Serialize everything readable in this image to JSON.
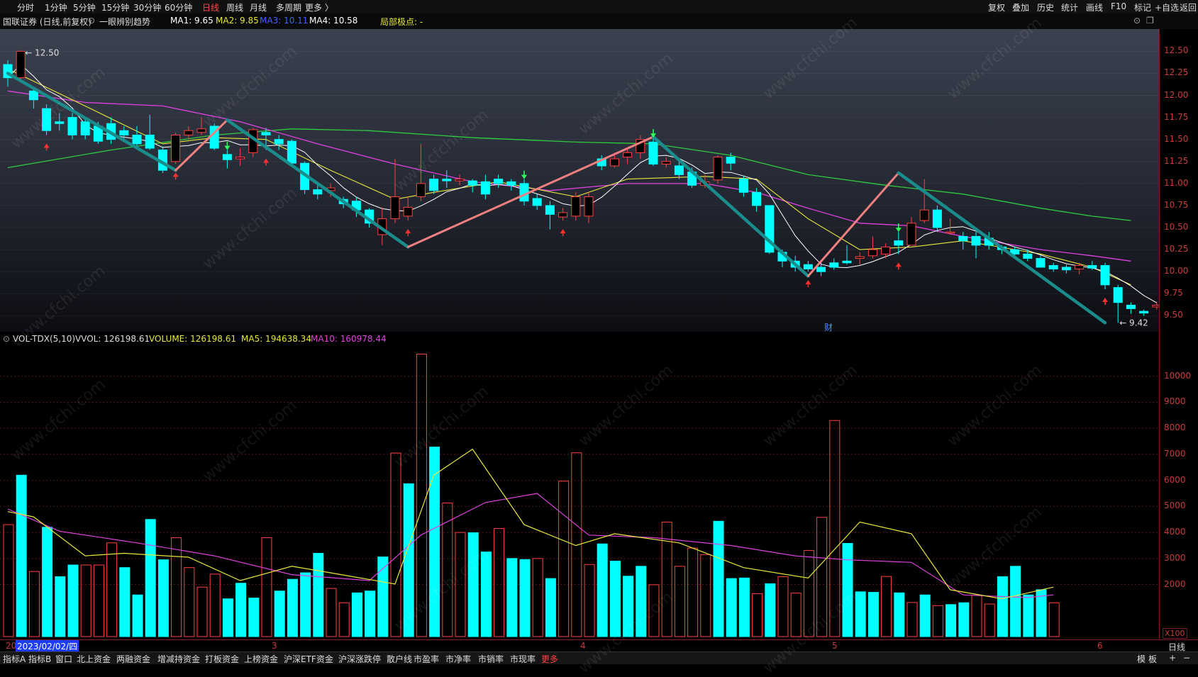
{
  "colors": {
    "up": "#ff4040",
    "down": "#00ffff",
    "ma1": "#ffffff",
    "ma2": "#e8e83a",
    "ma3": "#e040e0",
    "ma4": "#2ecc40",
    "zig_down": "#1a8c8c",
    "zig_up": "#f08080"
  },
  "topbar": {
    "periods": [
      "分时",
      "1分钟",
      "5分钟",
      "15分钟",
      "30分钟",
      "60分钟",
      "日线",
      "周线",
      "月线",
      "多周期",
      "更多 〉"
    ],
    "active_period": "日线",
    "right_tools": [
      "复权",
      "叠加",
      "历史",
      "统计",
      "画线",
      "F10",
      "标记",
      "+自选",
      "返回"
    ]
  },
  "info": {
    "stock": "国联证券 (日线,前复权)",
    "indicator": "一眼辨别趋势",
    "ma1": "MA1: 9.65",
    "ma2": "MA2: 9.85",
    "ma3": "MA3: 10.11",
    "ma4": "MA4: 10.58",
    "pivot": "局部极点: -"
  },
  "price_axis": [
    "12.50",
    "12.25",
    "12.00",
    "11.75",
    "11.50",
    "11.25",
    "11.00",
    "10.75",
    "10.50",
    "10.25",
    "10.00",
    "9.75",
    "9.50"
  ],
  "price_annotations": {
    "high": "12.50",
    "low": "9.42",
    "event": "财"
  },
  "vol_header": {
    "name": "VOL-TDX(5,10)",
    "vvol": "VVOL: 126198.61",
    "volume": "VOLUME: 126198.61",
    "ma5": "MA5: 194638.34",
    "ma10": "MA10: 160978.44"
  },
  "vol_axis": [
    "10000",
    "9000",
    "8000",
    "7000",
    "6000",
    "5000",
    "4000",
    "3000",
    "2000"
  ],
  "vol_unit": "X100",
  "date_bar": {
    "first": "20",
    "cursor_date": "2023/02/02/四",
    "months": [
      "3",
      "4",
      "5",
      "6"
    ],
    "right_label": "日线"
  },
  "bottom_tabs": [
    "指标A",
    "指标B",
    "窗口",
    "北上资金",
    "两融资金",
    "增减持资金",
    "打板资金",
    "上榜资金",
    "沪深ETF资金",
    "沪深涨跌停",
    "散户线",
    "市盈率",
    "市净率",
    "市销率",
    "市现率",
    "更多"
  ],
  "bottom_right": [
    "模",
    "板",
    "+",
    "−"
  ],
  "watermark": "www.cfchi.com",
  "chart_data": {
    "type": "candlestick",
    "ohlc": [
      [
        12.35,
        12.2,
        12.4,
        12.1
      ],
      [
        12.2,
        12.5,
        12.5,
        12.15
      ],
      [
        12.05,
        11.95,
        12.1,
        11.85
      ],
      [
        11.85,
        11.6,
        11.9,
        11.55
      ],
      [
        11.7,
        11.68,
        11.8,
        11.6
      ],
      [
        11.75,
        11.55,
        11.8,
        11.5
      ],
      [
        11.7,
        11.55,
        11.75,
        11.5
      ],
      [
        11.65,
        11.48,
        11.7,
        11.45
      ],
      [
        11.68,
        11.5,
        11.75,
        11.45
      ],
      [
        11.6,
        11.55,
        11.65,
        11.5
      ],
      [
        11.55,
        11.45,
        11.65,
        11.42
      ],
      [
        11.55,
        11.4,
        11.78,
        11.38
      ],
      [
        11.38,
        11.15,
        11.42,
        11.12
      ],
      [
        11.25,
        11.55,
        11.58,
        11.22
      ],
      [
        11.55,
        11.6,
        11.65,
        11.5
      ],
      [
        11.58,
        11.62,
        11.75,
        11.55
      ],
      [
        11.65,
        11.4,
        11.68,
        11.38
      ],
      [
        11.33,
        11.27,
        11.38,
        11.17
      ],
      [
        11.28,
        11.3,
        11.4,
        11.2
      ],
      [
        11.35,
        11.61,
        11.63,
        11.3
      ],
      [
        11.58,
        11.55,
        11.63,
        11.38
      ],
      [
        11.5,
        11.45,
        11.55,
        11.38
      ],
      [
        11.48,
        11.23,
        11.5,
        11.2
      ],
      [
        11.23,
        10.93,
        11.25,
        10.88
      ],
      [
        10.93,
        10.88,
        10.98,
        10.82
      ],
      [
        10.92,
        10.95,
        11.0,
        10.85
      ],
      [
        10.82,
        10.77,
        10.85,
        10.72
      ],
      [
        10.8,
        10.7,
        10.85,
        10.62
      ],
      [
        10.7,
        10.55,
        10.72,
        10.5
      ],
      [
        10.42,
        10.6,
        10.73,
        10.3
      ],
      [
        10.6,
        10.85,
        11.28,
        10.55
      ],
      [
        10.63,
        10.73,
        10.85,
        10.58
      ],
      [
        10.85,
        11.0,
        11.45,
        10.8
      ],
      [
        11.05,
        10.92,
        11.1,
        10.88
      ],
      [
        11.05,
        11.03,
        11.15,
        10.95
      ],
      [
        11.03,
        11.05,
        11.1,
        10.98
      ],
      [
        11.03,
        10.98,
        11.05,
        10.9
      ],
      [
        11.02,
        10.88,
        11.1,
        10.82
      ],
      [
        11.05,
        11.0,
        11.1,
        10.95
      ],
      [
        11.02,
        10.98,
        11.05,
        10.92
      ],
      [
        11.0,
        10.8,
        11.05,
        10.75
      ],
      [
        10.83,
        10.75,
        10.88,
        10.7
      ],
      [
        10.75,
        10.65,
        10.8,
        10.48
      ],
      [
        10.62,
        10.67,
        10.72,
        10.58
      ],
      [
        10.63,
        10.85,
        10.9,
        10.58
      ],
      [
        10.63,
        10.85,
        10.9,
        10.55
      ],
      [
        11.28,
        11.2,
        11.32,
        11.15
      ],
      [
        11.2,
        11.28,
        11.35,
        11.18
      ],
      [
        11.3,
        11.35,
        11.4,
        11.22
      ],
      [
        11.35,
        11.5,
        11.55,
        11.28
      ],
      [
        11.47,
        11.22,
        11.52,
        11.2
      ],
      [
        11.22,
        11.25,
        11.3,
        11.18
      ],
      [
        11.2,
        11.1,
        11.25,
        11.05
      ],
      [
        11.13,
        10.98,
        11.18,
        10.95
      ],
      [
        10.98,
        11.02,
        11.1,
        10.95
      ],
      [
        11.04,
        11.3,
        11.32,
        11.0
      ],
      [
        11.3,
        11.23,
        11.35,
        11.15
      ],
      [
        11.05,
        10.9,
        11.08,
        10.85
      ],
      [
        10.9,
        10.75,
        10.95,
        10.68
      ],
      [
        10.75,
        10.22,
        10.75,
        10.2
      ],
      [
        10.22,
        10.12,
        10.25,
        10.05
      ],
      [
        10.12,
        10.05,
        10.18,
        10.0
      ],
      [
        10.08,
        10.03,
        10.12,
        10.0
      ],
      [
        10.05,
        10.0,
        10.1,
        9.95
      ],
      [
        10.1,
        10.05,
        10.15,
        10.02
      ],
      [
        10.12,
        10.1,
        10.3,
        10.08
      ],
      [
        10.15,
        10.17,
        10.22,
        10.08
      ],
      [
        10.18,
        10.25,
        10.4,
        10.15
      ],
      [
        10.2,
        10.28,
        10.32,
        10.15
      ],
      [
        10.35,
        10.3,
        10.45,
        10.2
      ],
      [
        10.3,
        10.55,
        10.62,
        10.3
      ],
      [
        10.58,
        10.7,
        11.05,
        10.55
      ],
      [
        10.7,
        10.5,
        10.75,
        10.45
      ],
      [
        10.45,
        10.45,
        10.6,
        10.42
      ],
      [
        10.4,
        10.35,
        10.45,
        10.25
      ],
      [
        10.4,
        10.3,
        10.45,
        10.15
      ],
      [
        10.38,
        10.3,
        10.45,
        10.25
      ],
      [
        10.28,
        10.25,
        10.3,
        10.2
      ],
      [
        10.25,
        10.2,
        10.28,
        10.15
      ],
      [
        10.2,
        10.15,
        10.25,
        10.12
      ],
      [
        10.15,
        10.05,
        10.18,
        10.05
      ],
      [
        10.07,
        10.03,
        10.1,
        10.0
      ],
      [
        10.05,
        10.02,
        10.08,
        9.98
      ],
      [
        10.03,
        10.07,
        10.1,
        9.97
      ],
      [
        10.07,
        10.04,
        10.12,
        10.02
      ],
      [
        10.07,
        9.85,
        10.1,
        9.8
      ],
      [
        9.82,
        9.65,
        9.85,
        9.42
      ],
      [
        9.62,
        9.58,
        9.65,
        9.52
      ],
      [
        9.55,
        9.53,
        9.57,
        9.5
      ],
      [
        9.6,
        9.62,
        9.66,
        9.57
      ]
    ],
    "volume": [
      4300,
      6200,
      2500,
      4200,
      2300,
      2750,
      2750,
      2750,
      3600,
      2650,
      1600,
      4500,
      2950,
      3800,
      2650,
      1900,
      2400,
      1450,
      2050,
      1480,
      3800,
      1750,
      2200,
      2450,
      3200,
      1850,
      1300,
      1680,
      1750,
      3060,
      7050,
      5870,
      10850,
      7280,
      5130,
      4000,
      3990,
      3250,
      4150,
      3000,
      2960,
      3000,
      2230,
      5970,
      7060,
      2770,
      3560,
      2900,
      2320,
      2700,
      1990,
      4400,
      2700,
      3400,
      3150,
      4430,
      2230,
      2250,
      1650,
      2030,
      2300,
      1670,
      3310,
      4580,
      8300,
      3580,
      1720,
      1700,
      2310,
      1680,
      1310,
      1600,
      1190,
      1230,
      1300,
      1590,
      1250,
      2300,
      2700,
      1600,
      1800,
      1300
    ],
    "volume_up_flags": [
      1,
      0,
      1,
      0,
      0,
      0,
      1,
      1,
      1,
      0,
      0,
      0,
      0,
      1,
      1,
      1,
      1,
      0,
      0,
      0,
      1,
      0,
      0,
      0,
      0,
      1,
      1,
      0,
      0,
      0,
      1,
      0,
      1,
      0,
      1,
      1,
      0,
      0,
      1,
      0,
      0,
      1,
      0,
      1,
      1,
      1,
      0,
      0,
      0,
      0,
      1,
      1,
      1,
      1,
      1,
      0,
      0,
      0,
      1,
      0,
      1,
      1,
      1,
      1,
      1,
      0,
      0,
      0,
      1,
      0,
      1,
      0,
      1,
      0,
      0,
      1,
      1,
      0,
      0,
      0,
      0,
      1
    ],
    "ma2_line": [
      [
        0,
        12.3
      ],
      [
        5,
        11.95
      ],
      [
        12,
        11.45
      ],
      [
        16,
        11.52
      ],
      [
        20,
        11.5
      ],
      [
        25,
        11.15
      ],
      [
        30,
        10.82
      ],
      [
        33,
        10.9
      ],
      [
        38,
        11.02
      ],
      [
        44,
        10.85
      ],
      [
        48,
        11.05
      ],
      [
        54,
        11.08
      ],
      [
        58,
        11.05
      ],
      [
        62,
        10.6
      ],
      [
        66,
        10.25
      ],
      [
        70,
        10.28
      ],
      [
        74,
        10.35
      ],
      [
        80,
        10.2
      ],
      [
        84,
        10.05
      ],
      [
        87,
        9.85
      ]
    ],
    "ma3_line": [
      [
        0,
        12.05
      ],
      [
        6,
        11.92
      ],
      [
        12,
        11.88
      ],
      [
        18,
        11.7
      ],
      [
        24,
        11.45
      ],
      [
        30,
        11.22
      ],
      [
        36,
        11.02
      ],
      [
        42,
        10.92
      ],
      [
        48,
        11.0
      ],
      [
        54,
        11.0
      ],
      [
        58,
        10.9
      ],
      [
        62,
        10.72
      ],
      [
        66,
        10.55
      ],
      [
        70,
        10.52
      ],
      [
        74,
        10.4
      ],
      [
        80,
        10.25
      ],
      [
        84,
        10.18
      ],
      [
        87,
        10.12
      ]
    ],
    "ma4_line": [
      [
        0,
        11.18
      ],
      [
        8,
        11.38
      ],
      [
        16,
        11.55
      ],
      [
        22,
        11.62
      ],
      [
        28,
        11.6
      ],
      [
        36,
        11.52
      ],
      [
        44,
        11.47
      ],
      [
        50,
        11.45
      ],
      [
        56,
        11.32
      ],
      [
        62,
        11.1
      ],
      [
        68,
        10.98
      ],
      [
        74,
        10.88
      ],
      [
        80,
        10.72
      ],
      [
        84,
        10.63
      ],
      [
        87,
        10.58
      ]
    ],
    "zigzag": [
      [
        0,
        12.25
      ],
      [
        13,
        11.15
      ],
      [
        17,
        11.72
      ],
      [
        31,
        10.28
      ],
      [
        50,
        11.53
      ],
      [
        62,
        9.95
      ],
      [
        69,
        11.12
      ],
      [
        85,
        9.42
      ]
    ],
    "vol_ma5": [
      [
        0,
        4800
      ],
      [
        2,
        4600
      ],
      [
        6,
        3100
      ],
      [
        9,
        3200
      ],
      [
        14,
        3050
      ],
      [
        18,
        2150
      ],
      [
        22,
        2700
      ],
      [
        25,
        2450
      ],
      [
        30,
        2020
      ],
      [
        33,
        6200
      ],
      [
        36,
        7200
      ],
      [
        40,
        4300
      ],
      [
        44,
        3500
      ],
      [
        47,
        3950
      ],
      [
        52,
        3600
      ],
      [
        57,
        2650
      ],
      [
        62,
        2250
      ],
      [
        66,
        4400
      ],
      [
        70,
        3950
      ],
      [
        73,
        1800
      ],
      [
        77,
        1450
      ],
      [
        81,
        1900
      ]
    ],
    "vol_ma10": [
      [
        0,
        4900
      ],
      [
        4,
        4050
      ],
      [
        10,
        3600
      ],
      [
        16,
        3100
      ],
      [
        22,
        2380
      ],
      [
        28,
        2150
      ],
      [
        32,
        3900
      ],
      [
        37,
        5150
      ],
      [
        41,
        5500
      ],
      [
        45,
        3900
      ],
      [
        50,
        3800
      ],
      [
        56,
        3500
      ],
      [
        61,
        3100
      ],
      [
        65,
        2950
      ],
      [
        70,
        2850
      ],
      [
        74,
        1600
      ],
      [
        79,
        1500
      ],
      [
        81,
        1600
      ]
    ],
    "y_range": [
      9.35,
      12.72
    ],
    "vol_range": [
      0,
      11000
    ]
  }
}
